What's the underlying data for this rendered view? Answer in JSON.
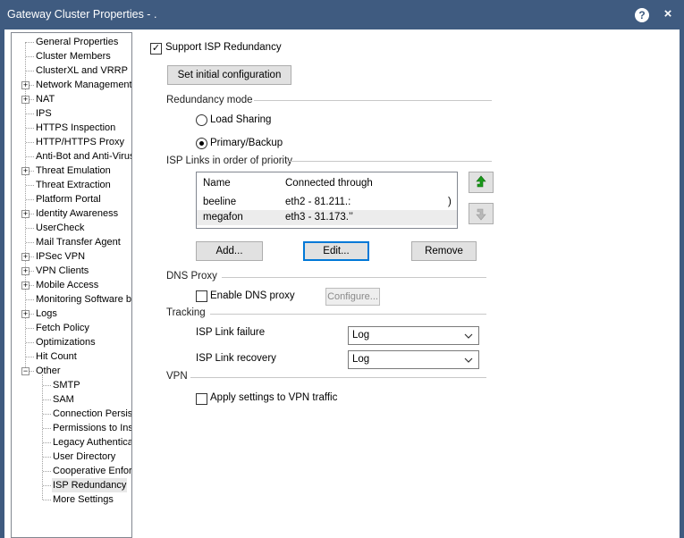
{
  "window": {
    "title": "Gateway Cluster Properties - .",
    "help_label": "?",
    "close_label": "×"
  },
  "tree": {
    "items": [
      {
        "label": "General Properties",
        "expandable": false
      },
      {
        "label": "Cluster Members",
        "expandable": false
      },
      {
        "label": "ClusterXL and VRRP",
        "expandable": false
      },
      {
        "label": "Network Management",
        "expandable": true
      },
      {
        "label": "NAT",
        "expandable": true
      },
      {
        "label": "IPS",
        "expandable": false
      },
      {
        "label": "HTTPS Inspection",
        "expandable": false
      },
      {
        "label": "HTTP/HTTPS Proxy",
        "expandable": false
      },
      {
        "label": "Anti-Bot and Anti-Virus",
        "expandable": false
      },
      {
        "label": "Threat Emulation",
        "expandable": true
      },
      {
        "label": "Threat Extraction",
        "expandable": false
      },
      {
        "label": "Platform Portal",
        "expandable": false
      },
      {
        "label": "Identity Awareness",
        "expandable": true
      },
      {
        "label": "UserCheck",
        "expandable": false
      },
      {
        "label": "Mail Transfer Agent",
        "expandable": false
      },
      {
        "label": "IPSec VPN",
        "expandable": true
      },
      {
        "label": "VPN Clients",
        "expandable": true
      },
      {
        "label": "Mobile Access",
        "expandable": true
      },
      {
        "label": "Monitoring Software bl",
        "expandable": false
      },
      {
        "label": "Logs",
        "expandable": true
      },
      {
        "label": "Fetch Policy",
        "expandable": false
      },
      {
        "label": "Optimizations",
        "expandable": false
      },
      {
        "label": "Hit Count",
        "expandable": false
      },
      {
        "label": "Other",
        "expandable": true,
        "expanded": true
      }
    ],
    "other_children": [
      "SMTP",
      "SAM",
      "Connection Persist",
      "Permissions to Inst",
      "Legacy Authentica",
      "User Directory",
      "Cooperative Enforc",
      "ISP Redundancy",
      "More Settings"
    ],
    "selected": "ISP Redundancy",
    "expander_collapsed": "+",
    "expander_expanded": "−"
  },
  "main": {
    "support_isp_label": "Support ISP Redundancy",
    "support_isp_checked": true,
    "set_initial_label": "Set initial configuration",
    "redundancy_mode_label": "Redundancy mode",
    "load_sharing_label": "Load Sharing",
    "primary_backup_label": "Primary/Backup",
    "mode_selected": "Primary/Backup",
    "isp_links_label": "ISP Links in order of priority",
    "links_table": {
      "columns": [
        "Name",
        "Connected through"
      ],
      "rows": [
        {
          "name": "beeline",
          "through": "eth2 - 81.211.:",
          "tail": ")"
        },
        {
          "name": "megafon",
          "through": "eth3 - 31.173.’’"
        }
      ]
    },
    "move_up_icon": "green-up-arrow",
    "move_down_icon": "gray-down-arrow",
    "add_label": "Add...",
    "edit_label": "Edit...",
    "remove_label": "Remove",
    "dns_proxy_label": "DNS Proxy",
    "enable_dns_label": "Enable DNS proxy",
    "configure_label": "Configure...",
    "tracking_label": "Tracking",
    "isp_failure_label": "ISP Link failure",
    "isp_failure_value": "Log",
    "isp_recovery_label": "ISP Link recovery",
    "isp_recovery_value": "Log",
    "vpn_label": "VPN",
    "apply_vpn_label": "Apply settings to VPN traffic"
  },
  "colors": {
    "titlebar": "#3f5b80",
    "green_arrow": "#1a9a1a",
    "focus_border": "#0078d7"
  }
}
